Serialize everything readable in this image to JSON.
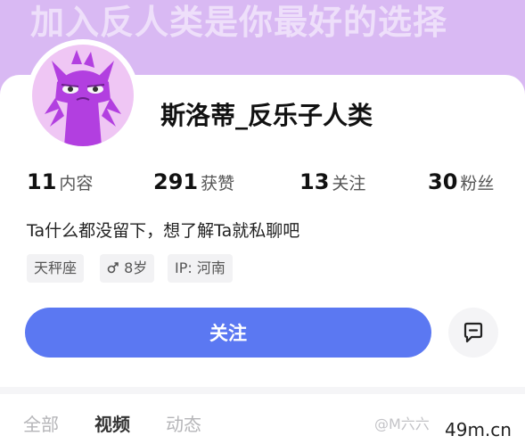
{
  "banner": {
    "text": "加入反人类是你最好的选择"
  },
  "profile": {
    "username": "斯洛蒂_反乐子人类",
    "bio": "Ta什么都没留下，想了解Ta就私聊吧"
  },
  "stats": [
    {
      "num": "11",
      "label": "内容"
    },
    {
      "num": "291",
      "label": "获赞"
    },
    {
      "num": "13",
      "label": "关注"
    },
    {
      "num": "30",
      "label": "粉丝"
    }
  ],
  "tags": {
    "zodiac": "天秤座",
    "age_icon": "male-symbol-icon",
    "age": "8岁",
    "ip": "IP: 河南"
  },
  "actions": {
    "follow_label": "关注",
    "message_icon": "chat-bubble-icon"
  },
  "tabs": [
    {
      "label": "全部"
    },
    {
      "label": "视频"
    },
    {
      "label": "动态"
    }
  ],
  "watermarks": {
    "faint": "@M六六",
    "site": "49m.cn"
  },
  "colors": {
    "banner": "#d9b9f3",
    "avatar_bg": "#efc6f4",
    "avatar_figure": "#b23fe0",
    "follow_button": "#5b78f2"
  }
}
